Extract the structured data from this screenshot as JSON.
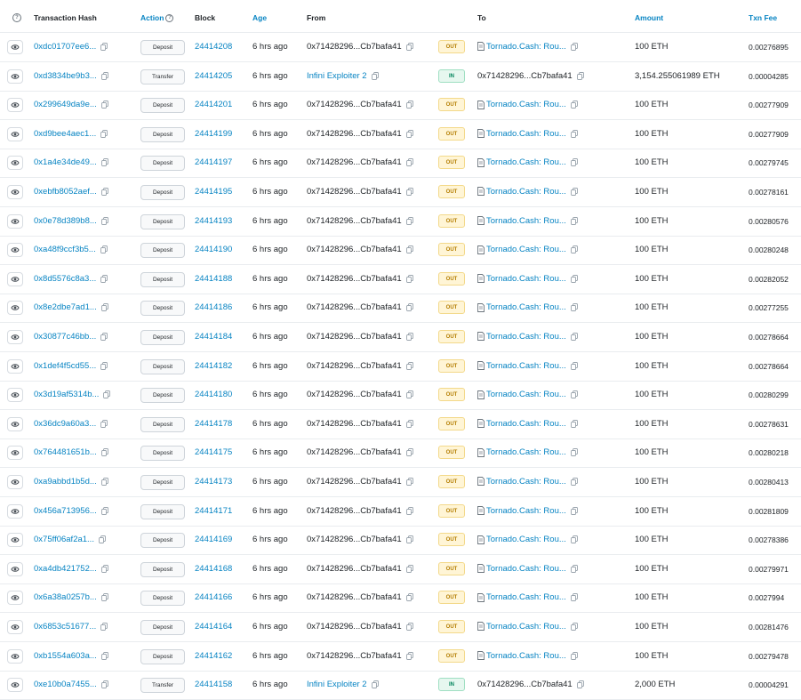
{
  "header": {
    "help_icon": "?",
    "tx_hash": "Transaction Hash",
    "action": "Action",
    "block": "Block",
    "age": "Age",
    "from": "From",
    "to": "To",
    "amount": "Amount",
    "fee": "Txn Fee"
  },
  "colors": {
    "link": "#0784c3",
    "out_bg": "#fff5d6",
    "out_text": "#b47d00",
    "in_bg": "#e6f7ef",
    "in_text": "#00845a"
  },
  "rows": [
    {
      "hash": "0xdc01707ee6...",
      "action": "Deposit",
      "block": "24414208",
      "age": "6 hrs ago",
      "from": "0x71428296...Cb7bafa41",
      "from_link": false,
      "dir": "OUT",
      "to": "Tornado.Cash: Rou...",
      "to_contract": true,
      "amount": "100 ETH",
      "fee": "0.00276895"
    },
    {
      "hash": "0xd3834be9b3...",
      "action": "Transfer",
      "block": "24414205",
      "age": "6 hrs ago",
      "from": "Infini Exploiter 2",
      "from_link": true,
      "dir": "IN",
      "to": "0x71428296...Cb7bafa41",
      "to_contract": false,
      "amount": "3,154.255061989 ETH",
      "fee": "0.00004285"
    },
    {
      "hash": "0x299649da9e...",
      "action": "Deposit",
      "block": "24414201",
      "age": "6 hrs ago",
      "from": "0x71428296...Cb7bafa41",
      "from_link": false,
      "dir": "OUT",
      "to": "Tornado.Cash: Rou...",
      "to_contract": true,
      "amount": "100 ETH",
      "fee": "0.00277909"
    },
    {
      "hash": "0xd9bee4aec1...",
      "action": "Deposit",
      "block": "24414199",
      "age": "6 hrs ago",
      "from": "0x71428296...Cb7bafa41",
      "from_link": false,
      "dir": "OUT",
      "to": "Tornado.Cash: Rou...",
      "to_contract": true,
      "amount": "100 ETH",
      "fee": "0.00277909"
    },
    {
      "hash": "0x1a4e34de49...",
      "action": "Deposit",
      "block": "24414197",
      "age": "6 hrs ago",
      "from": "0x71428296...Cb7bafa41",
      "from_link": false,
      "dir": "OUT",
      "to": "Tornado.Cash: Rou...",
      "to_contract": true,
      "amount": "100 ETH",
      "fee": "0.00279745"
    },
    {
      "hash": "0xebfb8052aef...",
      "action": "Deposit",
      "block": "24414195",
      "age": "6 hrs ago",
      "from": "0x71428296...Cb7bafa41",
      "from_link": false,
      "dir": "OUT",
      "to": "Tornado.Cash: Rou...",
      "to_contract": true,
      "amount": "100 ETH",
      "fee": "0.00278161"
    },
    {
      "hash": "0x0e78d389b8...",
      "action": "Deposit",
      "block": "24414193",
      "age": "6 hrs ago",
      "from": "0x71428296...Cb7bafa41",
      "from_link": false,
      "dir": "OUT",
      "to": "Tornado.Cash: Rou...",
      "to_contract": true,
      "amount": "100 ETH",
      "fee": "0.00280576"
    },
    {
      "hash": "0xa48f9ccf3b5...",
      "action": "Deposit",
      "block": "24414190",
      "age": "6 hrs ago",
      "from": "0x71428296...Cb7bafa41",
      "from_link": false,
      "dir": "OUT",
      "to": "Tornado.Cash: Rou...",
      "to_contract": true,
      "amount": "100 ETH",
      "fee": "0.00280248"
    },
    {
      "hash": "0x8d5576c8a3...",
      "action": "Deposit",
      "block": "24414188",
      "age": "6 hrs ago",
      "from": "0x71428296...Cb7bafa41",
      "from_link": false,
      "dir": "OUT",
      "to": "Tornado.Cash: Rou...",
      "to_contract": true,
      "amount": "100 ETH",
      "fee": "0.00282052"
    },
    {
      "hash": "0x8e2dbe7ad1...",
      "action": "Deposit",
      "block": "24414186",
      "age": "6 hrs ago",
      "from": "0x71428296...Cb7bafa41",
      "from_link": false,
      "dir": "OUT",
      "to": "Tornado.Cash: Rou...",
      "to_contract": true,
      "amount": "100 ETH",
      "fee": "0.00277255"
    },
    {
      "hash": "0x30877c46bb...",
      "action": "Deposit",
      "block": "24414184",
      "age": "6 hrs ago",
      "from": "0x71428296...Cb7bafa41",
      "from_link": false,
      "dir": "OUT",
      "to": "Tornado.Cash: Rou...",
      "to_contract": true,
      "amount": "100 ETH",
      "fee": "0.00278664"
    },
    {
      "hash": "0x1def4f5cd55...",
      "action": "Deposit",
      "block": "24414182",
      "age": "6 hrs ago",
      "from": "0x71428296...Cb7bafa41",
      "from_link": false,
      "dir": "OUT",
      "to": "Tornado.Cash: Rou...",
      "to_contract": true,
      "amount": "100 ETH",
      "fee": "0.00278664"
    },
    {
      "hash": "0x3d19af5314b...",
      "action": "Deposit",
      "block": "24414180",
      "age": "6 hrs ago",
      "from": "0x71428296...Cb7bafa41",
      "from_link": false,
      "dir": "OUT",
      "to": "Tornado.Cash: Rou...",
      "to_contract": true,
      "amount": "100 ETH",
      "fee": "0.00280299"
    },
    {
      "hash": "0x36dc9a60a3...",
      "action": "Deposit",
      "block": "24414178",
      "age": "6 hrs ago",
      "from": "0x71428296...Cb7bafa41",
      "from_link": false,
      "dir": "OUT",
      "to": "Tornado.Cash: Rou...",
      "to_contract": true,
      "amount": "100 ETH",
      "fee": "0.00278631"
    },
    {
      "hash": "0x764481651b...",
      "action": "Deposit",
      "block": "24414175",
      "age": "6 hrs ago",
      "from": "0x71428296...Cb7bafa41",
      "from_link": false,
      "dir": "OUT",
      "to": "Tornado.Cash: Rou...",
      "to_contract": true,
      "amount": "100 ETH",
      "fee": "0.00280218"
    },
    {
      "hash": "0xa9abbd1b5d...",
      "action": "Deposit",
      "block": "24414173",
      "age": "6 hrs ago",
      "from": "0x71428296...Cb7bafa41",
      "from_link": false,
      "dir": "OUT",
      "to": "Tornado.Cash: Rou...",
      "to_contract": true,
      "amount": "100 ETH",
      "fee": "0.00280413"
    },
    {
      "hash": "0x456a713956...",
      "action": "Deposit",
      "block": "24414171",
      "age": "6 hrs ago",
      "from": "0x71428296...Cb7bafa41",
      "from_link": false,
      "dir": "OUT",
      "to": "Tornado.Cash: Rou...",
      "to_contract": true,
      "amount": "100 ETH",
      "fee": "0.00281809"
    },
    {
      "hash": "0x75ff06af2a1...",
      "action": "Deposit",
      "block": "24414169",
      "age": "6 hrs ago",
      "from": "0x71428296...Cb7bafa41",
      "from_link": false,
      "dir": "OUT",
      "to": "Tornado.Cash: Rou...",
      "to_contract": true,
      "amount": "100 ETH",
      "fee": "0.00278386"
    },
    {
      "hash": "0xa4db421752...",
      "action": "Deposit",
      "block": "24414168",
      "age": "6 hrs ago",
      "from": "0x71428296...Cb7bafa41",
      "from_link": false,
      "dir": "OUT",
      "to": "Tornado.Cash: Rou...",
      "to_contract": true,
      "amount": "100 ETH",
      "fee": "0.00279971"
    },
    {
      "hash": "0x6a38a0257b...",
      "action": "Deposit",
      "block": "24414166",
      "age": "6 hrs ago",
      "from": "0x71428296...Cb7bafa41",
      "from_link": false,
      "dir": "OUT",
      "to": "Tornado.Cash: Rou...",
      "to_contract": true,
      "amount": "100 ETH",
      "fee": "0.0027994"
    },
    {
      "hash": "0x6853c51677...",
      "action": "Deposit",
      "block": "24414164",
      "age": "6 hrs ago",
      "from": "0x71428296...Cb7bafa41",
      "from_link": false,
      "dir": "OUT",
      "to": "Tornado.Cash: Rou...",
      "to_contract": true,
      "amount": "100 ETH",
      "fee": "0.00281476"
    },
    {
      "hash": "0xb1554a603a...",
      "action": "Deposit",
      "block": "24414162",
      "age": "6 hrs ago",
      "from": "0x71428296...Cb7bafa41",
      "from_link": false,
      "dir": "OUT",
      "to": "Tornado.Cash: Rou...",
      "to_contract": true,
      "amount": "100 ETH",
      "fee": "0.00279478"
    },
    {
      "hash": "0xe10b0a7455...",
      "action": "Transfer",
      "block": "24414158",
      "age": "6 hrs ago",
      "from": "Infini Exploiter 2",
      "from_link": true,
      "dir": "IN",
      "to": "0x71428296...Cb7bafa41",
      "to_contract": false,
      "amount": "2,000 ETH",
      "fee": "0.00004291"
    }
  ]
}
